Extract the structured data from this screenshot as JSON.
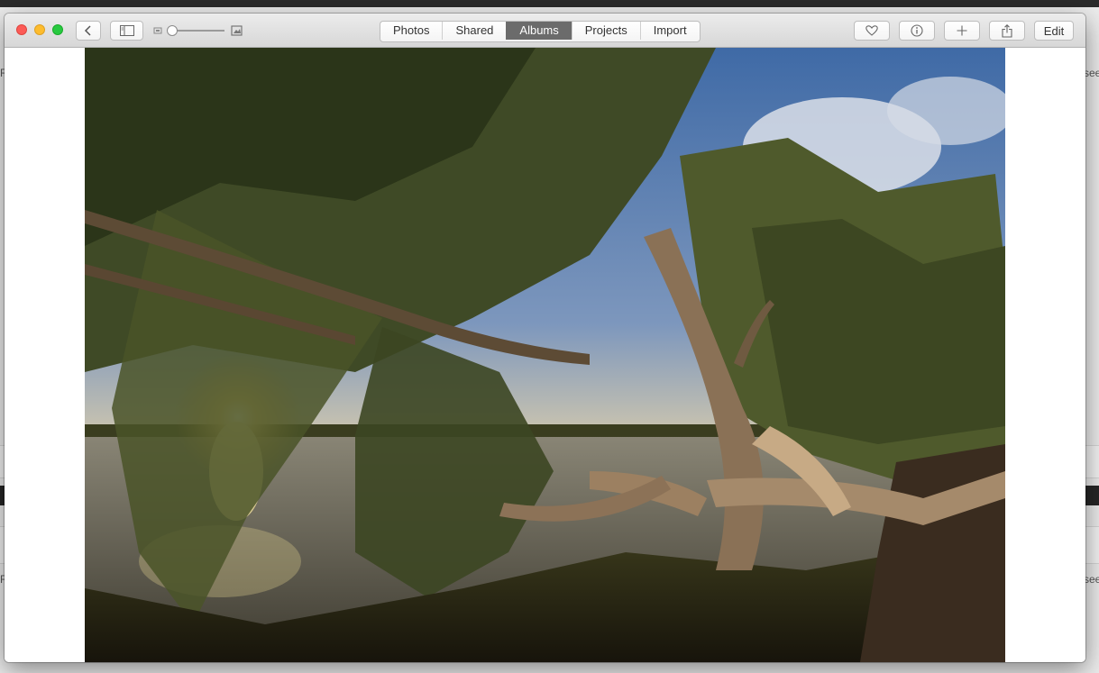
{
  "toolbar": {
    "tabs": [
      {
        "label": "Photos"
      },
      {
        "label": "Shared"
      },
      {
        "label": "Albums",
        "active": true
      },
      {
        "label": "Projects"
      },
      {
        "label": "Import"
      }
    ],
    "edit_label": "Edit"
  },
  "background": {
    "left_fragment_1": "R",
    "right_fragment_1": "see",
    "left_fragment_2": "R",
    "right_fragment_2": "see"
  },
  "colors": {
    "close": "#fc5b57",
    "minimize": "#fdbc2e",
    "maximize": "#28c940",
    "active_tab": "#6b6b6b"
  },
  "icons": {
    "back": "chevron-left-icon",
    "sidebar": "sidebar-icon",
    "favorite": "heart-icon",
    "info": "info-icon",
    "add": "plus-icon",
    "share": "share-icon"
  }
}
